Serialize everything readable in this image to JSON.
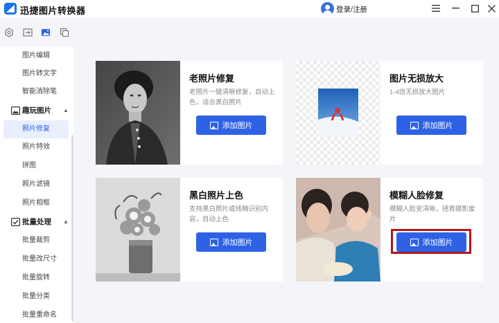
{
  "app": {
    "title": "迅捷图片转换器"
  },
  "header": {
    "login_label": "登录/注册"
  },
  "window_controls": [
    "menu",
    "minimize",
    "maximize",
    "close"
  ],
  "toolbar_icons": [
    "settings-icon",
    "convert-icon",
    "image-icon",
    "copy-icon"
  ],
  "sidebar": {
    "items_top": [
      {
        "label": "图片编辑"
      },
      {
        "label": "图片转文字"
      },
      {
        "label": "智能消除笔"
      }
    ],
    "category1": {
      "label": "趣玩图片",
      "icon": "image-category-icon"
    },
    "items_mid": [
      {
        "label": "照片修复",
        "active": true
      },
      {
        "label": "照片特效"
      },
      {
        "label": "拼图"
      },
      {
        "label": "照片滤镜"
      },
      {
        "label": "照片相框"
      }
    ],
    "category2": {
      "label": "批量处理",
      "icon": "batch-category-icon"
    },
    "items_bottom": [
      {
        "label": "批量裁剪"
      },
      {
        "label": "批量改尺寸"
      },
      {
        "label": "批量旋转"
      },
      {
        "label": "批量分类"
      },
      {
        "label": "批量重命名"
      }
    ]
  },
  "cards": [
    {
      "title": "老照片修复",
      "desc": "老照片一键清晰修复，自动上色，适合黑白照片",
      "button": "添加图片"
    },
    {
      "title": "图片无损放大",
      "desc": "1-4倍无损放大图片",
      "button": "添加图片"
    },
    {
      "title": "黑白照片上色",
      "desc": "支持黑白照片或线稿识别内容，自动上色",
      "button": "添加图片"
    },
    {
      "title": "模糊人脸修复",
      "desc": "模糊人脸变清晰，拯救摄影废片",
      "button": "添加图片"
    }
  ],
  "colors": {
    "accent": "#2e62e6",
    "highlight": "#b1161c",
    "active_bg": "#e9effe"
  }
}
